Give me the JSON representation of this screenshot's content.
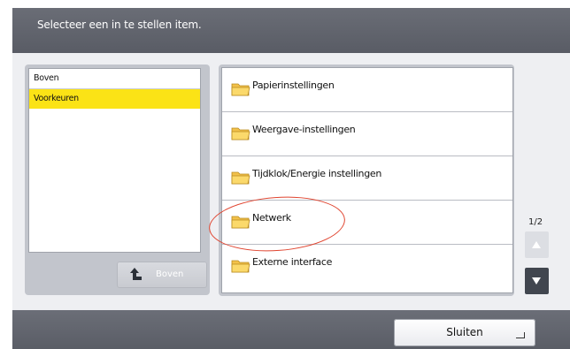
{
  "header": {
    "title": "Selecteer een in te stellen item."
  },
  "left_panel": {
    "items": [
      {
        "label": "Boven",
        "selected": false
      },
      {
        "label": "Voorkeuren",
        "selected": true
      }
    ],
    "up_button_label": "Boven",
    "up_button_icon": "return-up-arrow-icon"
  },
  "main_list": {
    "items": [
      {
        "label": "Papierinstellingen",
        "icon": "folder-icon"
      },
      {
        "label": "Weergave-instellingen",
        "icon": "folder-icon"
      },
      {
        "label": "Tijdklok/Energie instellingen",
        "icon": "folder-icon"
      },
      {
        "label": "Netwerk",
        "icon": "folder-icon",
        "highlighted": true
      },
      {
        "label": "Externe interface",
        "icon": "folder-icon"
      }
    ]
  },
  "pagination": {
    "indicator": "1/2",
    "up_enabled": false,
    "down_enabled": true
  },
  "footer": {
    "close_label": "Sluiten",
    "close_icon": "enter-icon"
  },
  "colors": {
    "header_bg": "#5f626b",
    "selection": "#fbe316",
    "annotation_oval": "#e0442f",
    "scroll_active": "#41464f"
  }
}
